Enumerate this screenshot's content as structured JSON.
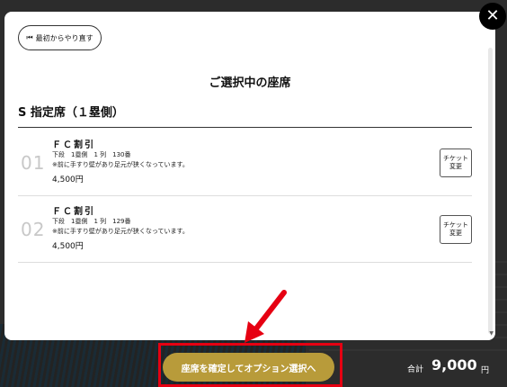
{
  "modal": {
    "restart_label": "最初からやり直す",
    "title": "ご選択中の座席",
    "section_title": "S 指定席（１塁側）",
    "close_symbol": "✕",
    "seats": [
      {
        "num": "01",
        "type": "ＦＣ割引",
        "detail": "下段　1塁側　1 列　130番",
        "note": "※前に手すり壁があり足元が狭くなっています。",
        "price": "4,500円",
        "change_line1": "チケット",
        "change_line2": "変更"
      },
      {
        "num": "02",
        "type": "ＦＣ割引",
        "detail": "下段　1塁側　1 列　129番",
        "note": "※前に手すり壁があり足元が狭くなっています。",
        "price": "4,500円",
        "change_line1": "チケット",
        "change_line2": "変更"
      }
    ]
  },
  "footer": {
    "confirm_label": "座席を確定してオプション選択へ",
    "total_label": "合計",
    "total_amount": "9,000",
    "total_unit": "円"
  },
  "colors": {
    "accent_gold": "#b89b3a",
    "highlight_red": "#e60012"
  }
}
